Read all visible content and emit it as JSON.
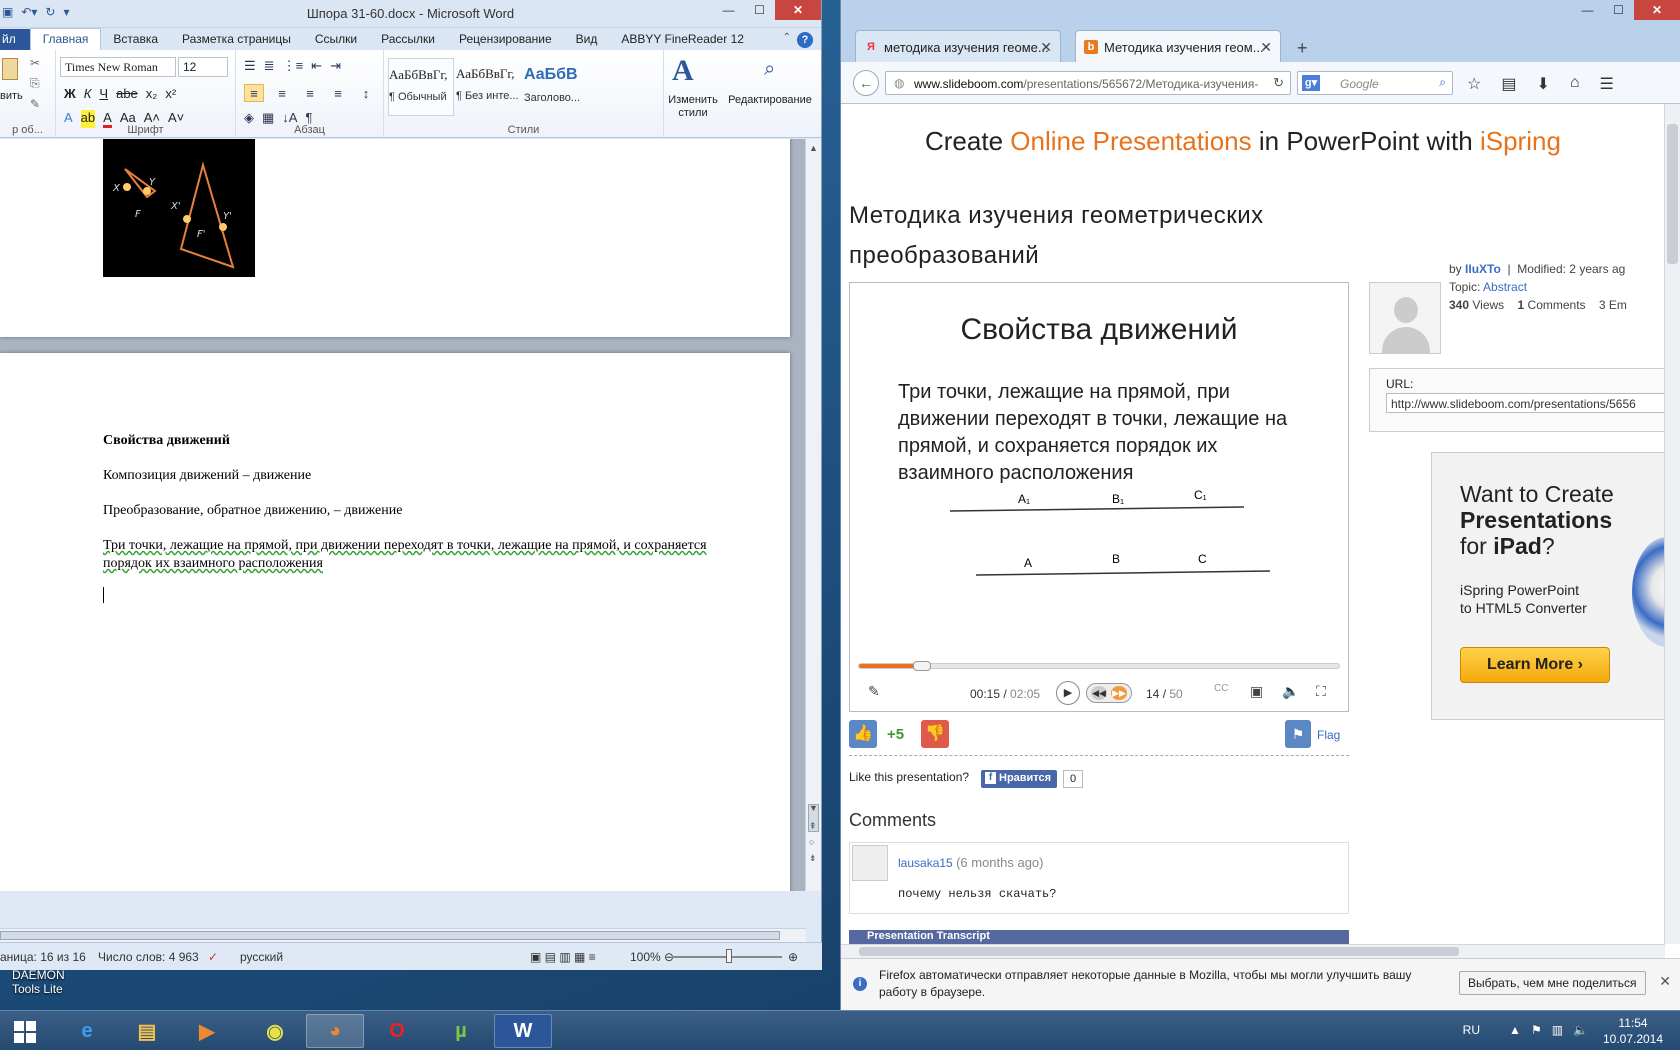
{
  "desktop": {
    "icon_label_1": "DAEMON",
    "icon_label_2": "Tools Lite"
  },
  "word": {
    "title": "Шпора 31-60.docx - Microsoft Word",
    "tabs": [
      "йл",
      "Главная",
      "Вставка",
      "Разметка страницы",
      "Ссылки",
      "Рассылки",
      "Рецензирование",
      "Вид",
      "ABBYY FineReader 12"
    ],
    "ribbon": {
      "paste_label": "вить",
      "clipboard_label": "р об...",
      "font_name": "Times New Roman",
      "font_size": "12",
      "font_group": "Шрифт",
      "para_group": "Абзац",
      "styles_group": "Стили",
      "styles": [
        {
          "sample": "АаБбВвГг,",
          "name": "¶ Обычный"
        },
        {
          "sample": "АаБбВвГг,",
          "name": "¶ Без инте..."
        },
        {
          "sample": "АаБбВ",
          "name": "Заголово..."
        }
      ],
      "change_styles": "Изменить стили",
      "editing": "Редактирование"
    },
    "doc": {
      "heading": "Свойства движений",
      "line1": "Композиция движений – движение",
      "line2": "Преобразование, обратное движению, – движение",
      "line3": "Три точки, лежащие на прямой, при движении переходят в точки, лежащие на прямой, и сохраняется порядок их взаимного расположения"
    },
    "status": {
      "page": "аница: 16 из 16",
      "words": "Число слов: 4 963",
      "lang": "русский",
      "zoom": "100%"
    }
  },
  "firefox": {
    "tabs": [
      {
        "title": "методика изучения геоме...",
        "favicon": "Я"
      },
      {
        "title": "Методика изучения геом...",
        "favicon": "b"
      }
    ],
    "url_domain": "www.slideboom.com",
    "url_path": "/presentations/565672/Методика-изучения-",
    "search_placeholder": "Google",
    "ad_top": {
      "p1": "Create ",
      "p2": "Online Presentations",
      "p3": " in PowerPoint with ",
      "p4": "iSpring"
    },
    "pres_title_1": "Методика изучения геометрических",
    "pres_title_2": "преобразований",
    "slide": {
      "title": "Свойства движений",
      "body": "Три точки, лежащие на прямой, при движении переходят в точки, лежащие на прямой, и сохраняется порядок их взаимного расположения",
      "labels_top": [
        "A₁",
        "B₁",
        "C₁"
      ],
      "labels_bottom": [
        "A",
        "B",
        "C"
      ]
    },
    "player": {
      "time": "00:15",
      "duration": "02:05",
      "slide": "14",
      "slides": "50",
      "progress": 0.12
    },
    "vote": {
      "count": "+5",
      "flag": "Flag"
    },
    "like_text": "Like this presentation?",
    "fb_label": "Нравится",
    "fb_count": "0",
    "comments_title": "Comments",
    "comment": {
      "user": "lausaka15",
      "age": "(6 months ago)",
      "text": "почему нельзя скачать?"
    },
    "transcript": "Presentation Transcript",
    "meta": {
      "by": "by",
      "author": "IIuXTo",
      "sep": "|",
      "modified": "Modified: 2 years ag",
      "topic_label": "Topic:",
      "topic": "Abstract",
      "views_n": "340",
      "views": "Views",
      "comments_n": "1",
      "comments": "Comments",
      "em": "3 Em"
    },
    "url_label": "URL:",
    "url_value": "http://www.slideboom.com/presentations/5656",
    "ispring_ad": {
      "l1": "Want to Create",
      "l2": "Presentations",
      "l3": "for ",
      "l3b": "iPad",
      "l3c": "?",
      "s1": "iSpring PowerPoint",
      "s2": "to HTML5 Converter",
      "button": "Learn More ›"
    },
    "notify": {
      "text": "Firefox автоматически отправляет некоторые данные в Mozilla, чтобы мы могли улучшить вашу работу в браузере.",
      "button": "Выбрать, чем мне поделиться"
    }
  },
  "taskbar": {
    "lang": "RU",
    "time": "11:54",
    "date": "10.07.2014"
  }
}
